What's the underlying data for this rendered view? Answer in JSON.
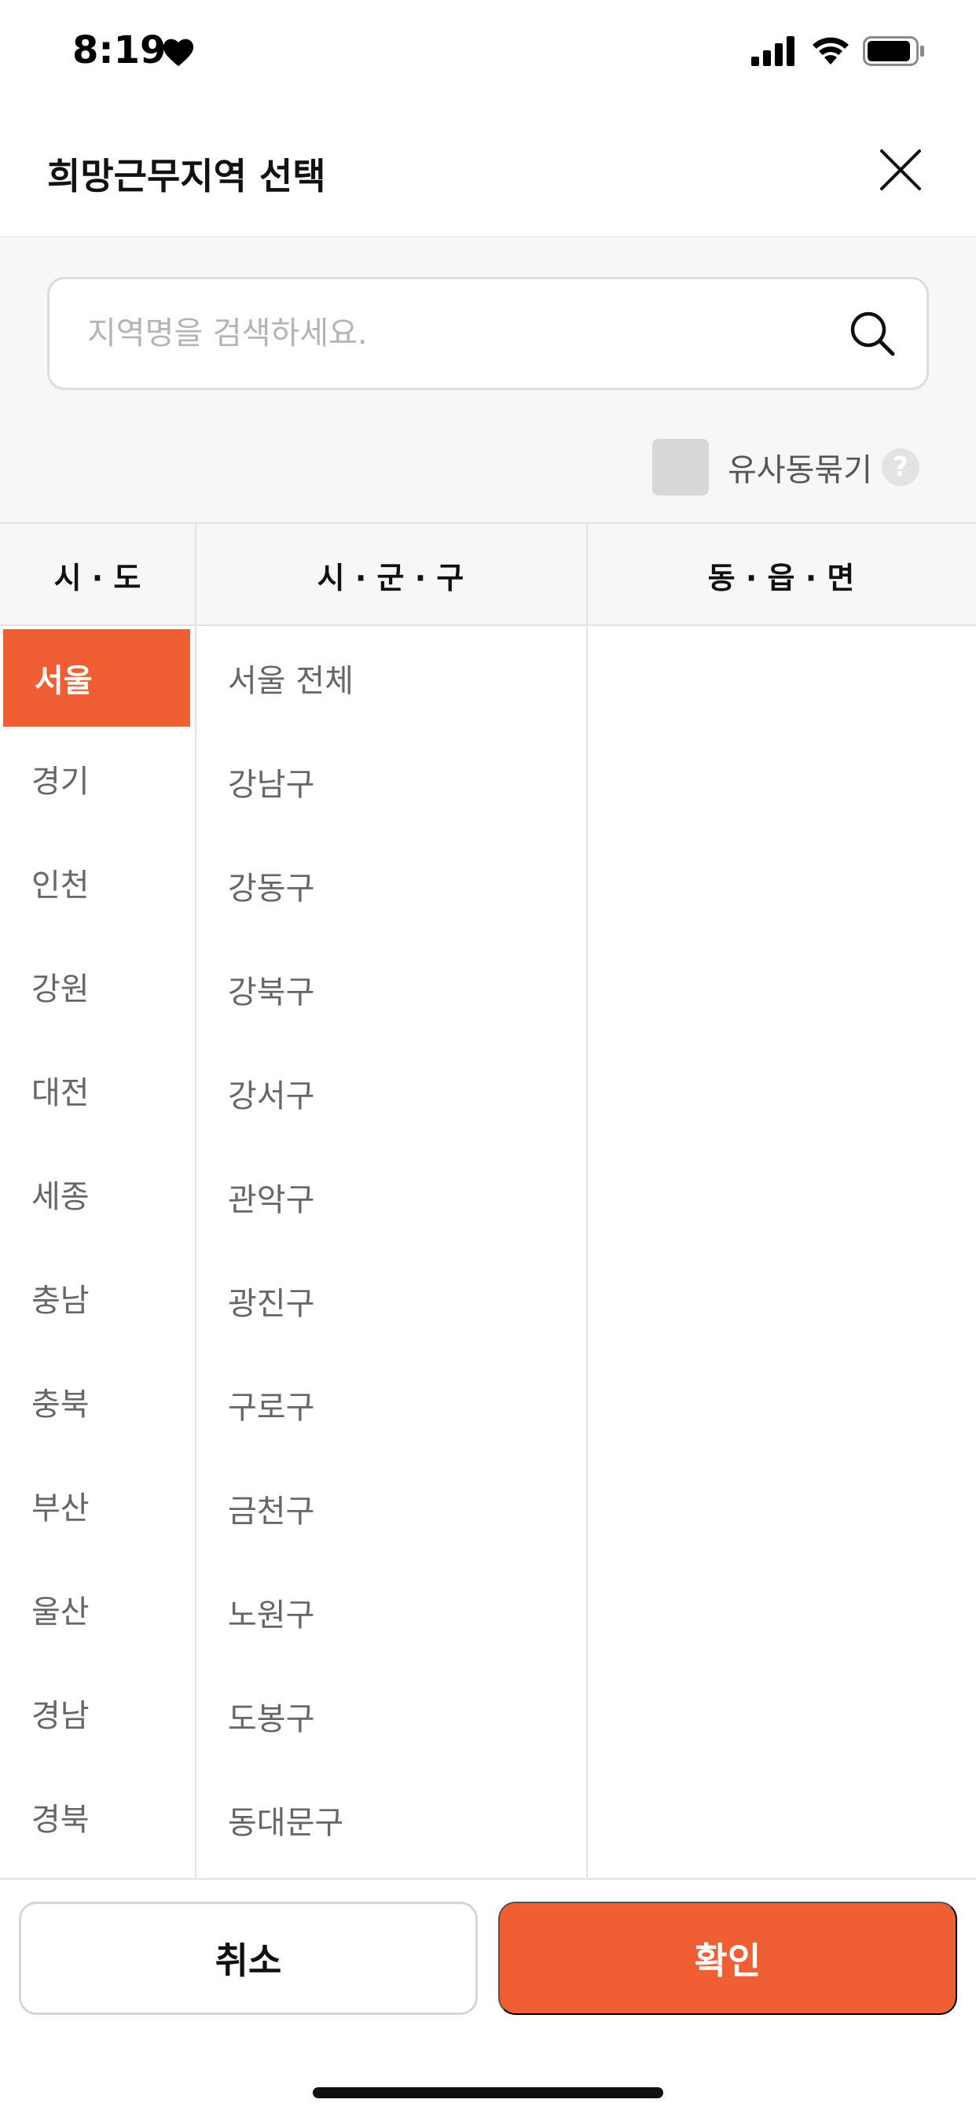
{
  "status": {
    "time": "8:19"
  },
  "header": {
    "title": "희망근무지역 선택"
  },
  "search": {
    "placeholder": "지역명을 검색하세요."
  },
  "options": {
    "merge_label": "유사동묶기",
    "help": "?"
  },
  "columns": {
    "sido": "시 · 도",
    "sigungu": "시 · 군 · 구",
    "dong": "동 · 읍 · 면"
  },
  "sido": [
    {
      "label": "서울",
      "selected": true
    },
    {
      "label": "경기"
    },
    {
      "label": "인천"
    },
    {
      "label": "강원"
    },
    {
      "label": "대전"
    },
    {
      "label": "세종"
    },
    {
      "label": "충남"
    },
    {
      "label": "충북"
    },
    {
      "label": "부산"
    },
    {
      "label": "울산"
    },
    {
      "label": "경남"
    },
    {
      "label": "경북"
    }
  ],
  "sigungu": [
    {
      "label": "서울 전체"
    },
    {
      "label": "강남구"
    },
    {
      "label": "강동구"
    },
    {
      "label": "강북구"
    },
    {
      "label": "강서구"
    },
    {
      "label": "관악구"
    },
    {
      "label": "광진구"
    },
    {
      "label": "구로구"
    },
    {
      "label": "금천구"
    },
    {
      "label": "노원구"
    },
    {
      "label": "도봉구"
    },
    {
      "label": "동대문구"
    }
  ],
  "footer": {
    "cancel_label": "취소",
    "ok_label": "확인"
  },
  "colors": {
    "accent": "#ef5f33"
  }
}
